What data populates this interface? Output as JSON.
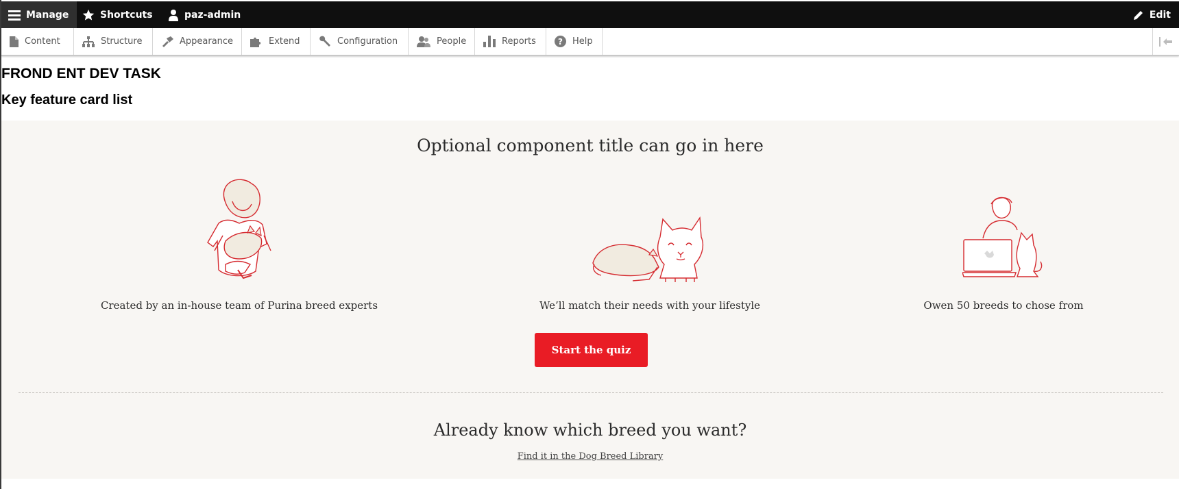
{
  "toolbar": {
    "manage_label": "Manage",
    "shortcuts_label": "Shortcuts",
    "user_label": "paz-admin",
    "edit_label": "Edit"
  },
  "tray": {
    "items": [
      {
        "label": "Content",
        "icon": "file-icon"
      },
      {
        "label": "Structure",
        "icon": "sitemap-icon"
      },
      {
        "label": "Appearance",
        "icon": "paintbrush-icon"
      },
      {
        "label": "Extend",
        "icon": "puzzle-icon"
      },
      {
        "label": "Configuration",
        "icon": "wrench-icon"
      },
      {
        "label": "People",
        "icon": "people-icon"
      },
      {
        "label": "Reports",
        "icon": "bar-chart-icon"
      },
      {
        "label": "Help",
        "icon": "question-icon"
      }
    ]
  },
  "page": {
    "site_title": "FROND ENT DEV TASK",
    "block_title": "Key feature card list"
  },
  "component": {
    "title": "Optional component title can go in here",
    "cards": [
      {
        "text": "Created by an in-house team of Purina breed experts",
        "icon": "person-holding-cat-illustration"
      },
      {
        "text": "We’ll match their needs with your lifestyle",
        "icon": "two-cats-illustration"
      },
      {
        "text": "Owen 50 breeds to chose from",
        "icon": "person-laptop-cat-illustration"
      }
    ],
    "cta_label": "Start the quiz",
    "breed_title": "Already know which breed you want?",
    "breed_link": "Find it in the Dog Breed Library"
  },
  "colors": {
    "toolbar_bg": "#0f0f0f",
    "manage_bg": "#2f2f2f",
    "panel_bg": "#f8f6f3",
    "accent_red": "#e91c25",
    "illustration_fill": "#f1ebe0"
  }
}
